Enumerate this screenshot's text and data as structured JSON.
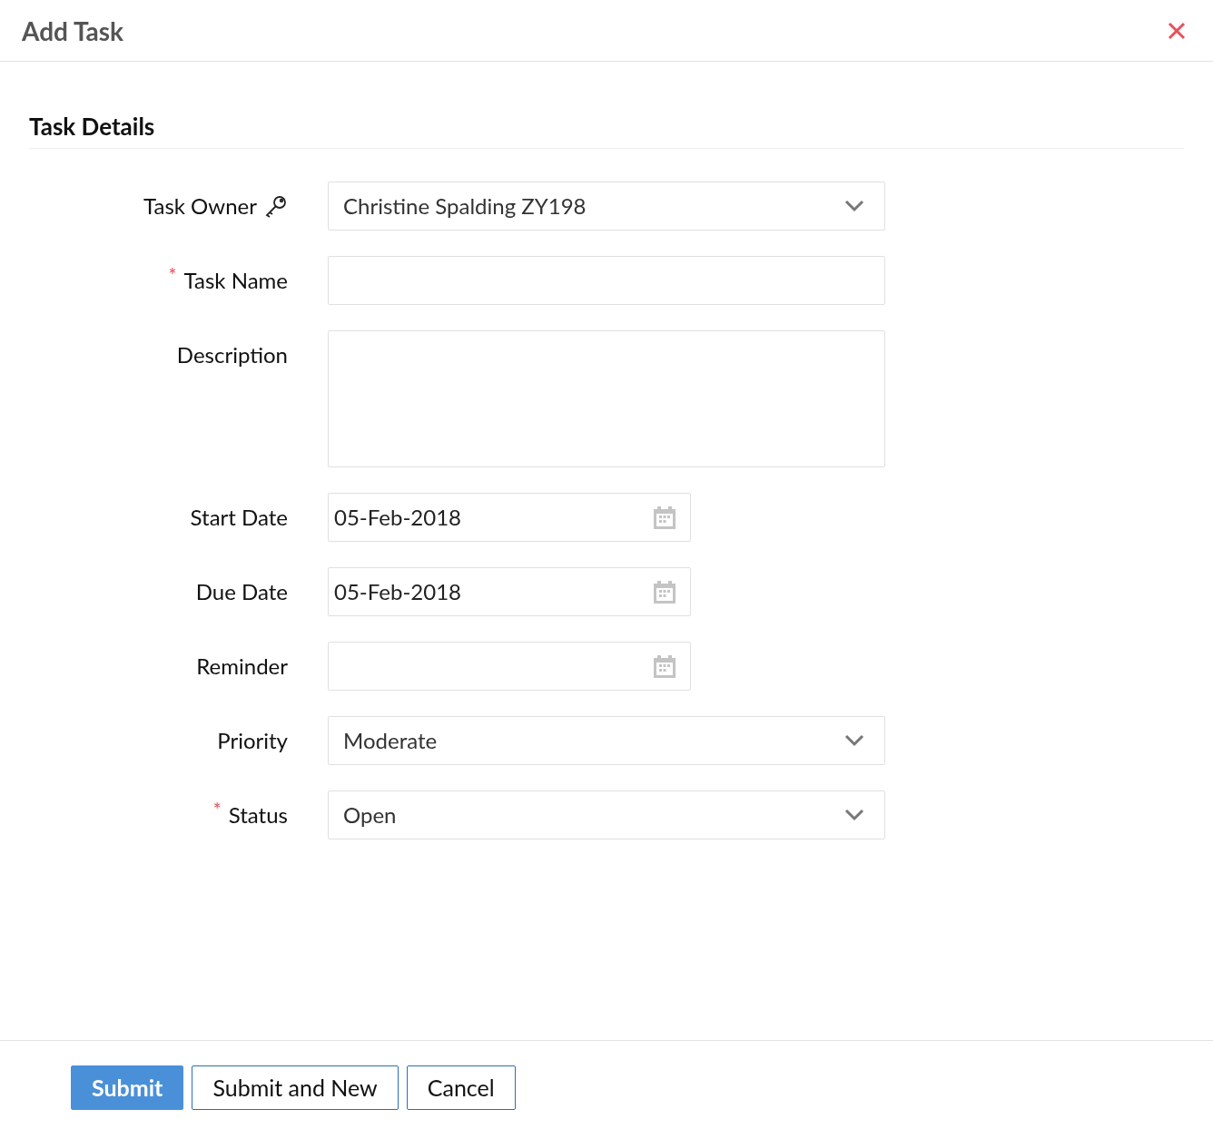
{
  "dialog": {
    "title": "Add Task"
  },
  "section": {
    "title": "Task Details"
  },
  "fields": [
    {
      "kind": "lookup",
      "label": "Task Owner",
      "value": "Christine Spalding ZY198"
    },
    {
      "kind": "text",
      "label": "Task Name",
      "required_mark": "*"
    },
    {
      "kind": "textarea",
      "label": "Description"
    },
    {
      "kind": "date",
      "label": "Start Date",
      "value": "05-Feb-2018"
    },
    {
      "kind": "date",
      "label": "Due Date",
      "value": "05-Feb-2018"
    },
    {
      "kind": "date",
      "label": "Reminder"
    },
    {
      "kind": "select",
      "label": "Priority",
      "value": "Moderate"
    },
    {
      "kind": "select",
      "label": "Status",
      "required_mark": "*",
      "value": "Open"
    }
  ],
  "buttons": [
    {
      "label": "Submit",
      "primary": true
    },
    {
      "label": "Submit and New",
      "primary": false
    },
    {
      "label": "Cancel",
      "primary": false
    }
  ]
}
